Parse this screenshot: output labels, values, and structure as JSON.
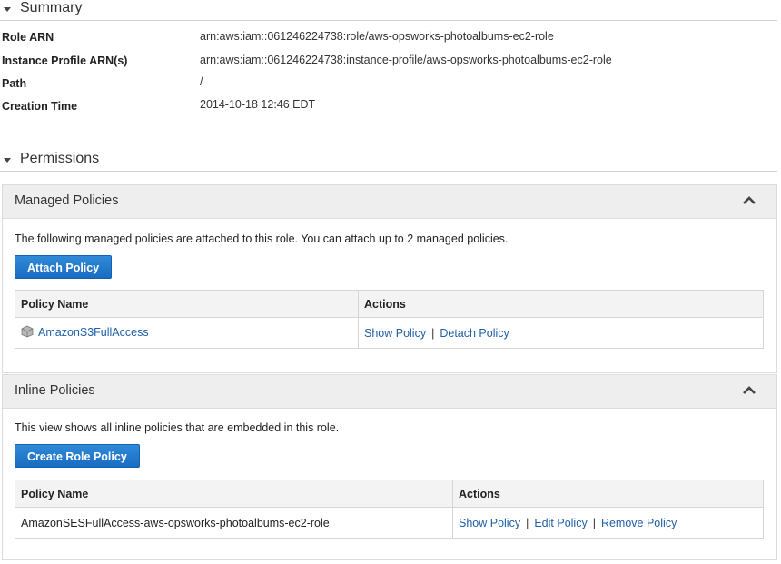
{
  "summary": {
    "title": "Summary",
    "fields": [
      {
        "label": "Role ARN",
        "value": "arn:aws:iam::061246224738:role/aws-opsworks-photoalbums-ec2-role"
      },
      {
        "label": "Instance Profile ARN(s)",
        "value": "arn:aws:iam::061246224738:instance-profile/aws-opsworks-photoalbums-ec2-role"
      },
      {
        "label": "Path",
        "value": "/"
      },
      {
        "label": "Creation Time",
        "value": "2014-10-18 12:46 EDT"
      }
    ]
  },
  "permissions": {
    "title": "Permissions",
    "managed": {
      "title": "Managed Policies",
      "description": "The following managed policies are attached to this role. You can attach up to 2 managed policies.",
      "button": "Attach Policy",
      "columns": [
        "Policy Name",
        "Actions"
      ],
      "rows": [
        {
          "name": "AmazonS3FullAccess",
          "icon": "package-icon",
          "actions": [
            "Show Policy",
            "Detach Policy"
          ]
        }
      ]
    },
    "inline": {
      "title": "Inline Policies",
      "description": "This view shows all inline policies that are embedded in this role.",
      "button": "Create Role Policy",
      "columns": [
        "Policy Name",
        "Actions"
      ],
      "rows": [
        {
          "name": "AmazonSESFullAccess-aws-opsworks-photoalbums-ec2-role",
          "actions": [
            "Show Policy",
            "Edit Policy",
            "Remove Policy"
          ]
        }
      ]
    }
  },
  "colors": {
    "accent": "#1a6cc1",
    "link": "#1f5fa8"
  }
}
